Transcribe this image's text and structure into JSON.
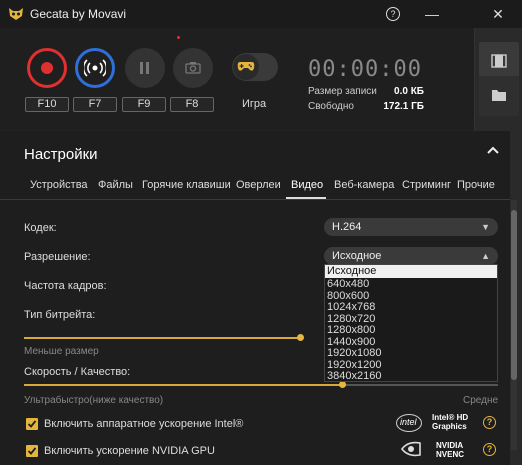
{
  "window": {
    "title": "Gecata by Movavi",
    "help": "?",
    "minimize": "—",
    "close": "✕"
  },
  "record": {
    "keys": [
      "F10",
      "F7",
      "F9",
      "F8"
    ],
    "game_label": "Игра",
    "timer": "00:00:00",
    "stats": [
      {
        "label": "Размер записи",
        "value": "0.0 КБ"
      },
      {
        "label": "Свободно",
        "value": "172.1 ГБ"
      }
    ]
  },
  "colors": {
    "accent": "#e4b53c",
    "record": "#e03030",
    "stream": "#2f6fd8"
  },
  "settings": {
    "title": "Настройки",
    "tabs": [
      "Устройства",
      "Файлы",
      "Горячие клавиши",
      "Оверлеи",
      "Видео",
      "Веб-камера",
      "Стриминг",
      "Прочие"
    ],
    "active_tab": "Видео",
    "codec": {
      "label": "Кодек:",
      "value": "H.264"
    },
    "resolution": {
      "label": "Разрешение:",
      "value": "Исходное",
      "options": [
        "Исходное",
        "640x480",
        "800x600",
        "1024x768",
        "1280x720",
        "1280x800",
        "1440x900",
        "1920x1080",
        "1920x1200",
        "3840x2160"
      ]
    },
    "fps": {
      "label": "Частота кадров:"
    },
    "bitrate": {
      "label": "Тип битрейта:",
      "left_caption": "Меньше размер",
      "level": 0.5
    },
    "speed": {
      "label": "Скорость / Качество:",
      "left_caption": "Ультрабыстро(ниже качество)",
      "right_caption": "Средне",
      "level": 0.67
    },
    "intel": {
      "label": "Включить аппаратное ускорение Intel®",
      "checked": true,
      "brand": "Intel® HD Graphics",
      "logo": "intel"
    },
    "nvidia": {
      "label": "Включить ускорение NVIDIA GPU",
      "checked": true,
      "brand": "NVIDIA NVENC"
    }
  }
}
